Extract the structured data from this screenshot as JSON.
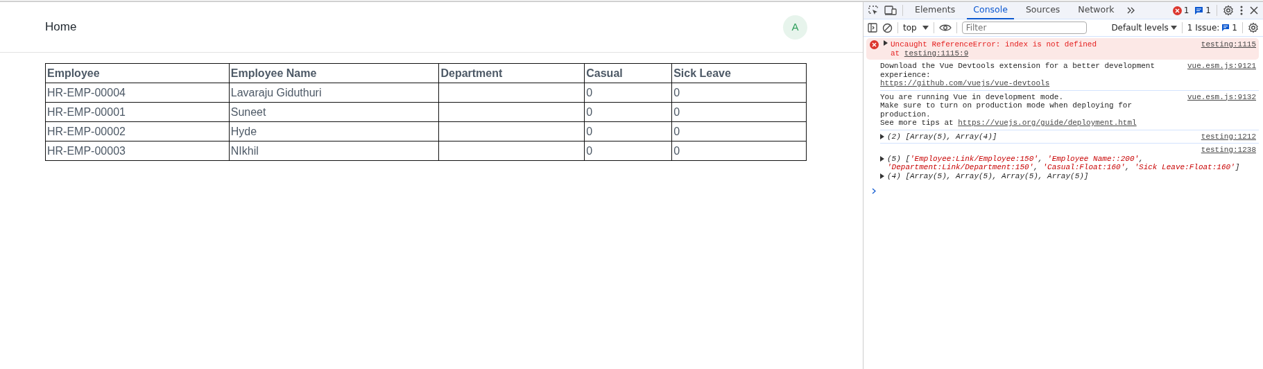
{
  "page": {
    "title": "Home",
    "avatar": "A",
    "table": {
      "columns": [
        "Employee",
        "Employee Name",
        "Department",
        "Casual",
        "Sick Leave"
      ],
      "rows": [
        [
          "HR-EMP-00004",
          "Lavaraju Giduthuri",
          "",
          "0",
          "0"
        ],
        [
          "HR-EMP-00001",
          "Suneet",
          "",
          "0",
          "0"
        ],
        [
          "HR-EMP-00002",
          "Hyde",
          "",
          "0",
          "0"
        ],
        [
          "HR-EMP-00003",
          "NIkhil",
          "",
          "0",
          "0"
        ]
      ]
    }
  },
  "devtools": {
    "tabs": [
      {
        "label": "Elements",
        "selected": false
      },
      {
        "label": "Console",
        "selected": true
      },
      {
        "label": "Sources",
        "selected": false
      },
      {
        "label": "Network",
        "selected": false
      }
    ],
    "error_count": "1",
    "message_count": "1",
    "context": "top",
    "filter": {
      "placeholder": "Filter"
    },
    "levels": "Default levels",
    "issues_label": "1 Issue:",
    "issues_count": "1",
    "messages": [
      {
        "kind": "error",
        "text": "Uncaught ReferenceError: index is not defined",
        "detail": "at ",
        "detail_link": "testing:1115:9",
        "source": "testing:1115"
      },
      {
        "kind": "info",
        "text": "Download the Vue Devtools extension for a better development experience:\n",
        "link": "https://github.com/vuejs/vue-devtools",
        "source": "vue.esm.js:9121"
      },
      {
        "kind": "info",
        "text": "You are running Vue in development mode.\nMake sure to turn on production mode when deploying for production.\nSee more tips at ",
        "link": "https://vuejs.org/guide/deployment.html",
        "source": "vue.esm.js:9132"
      },
      {
        "kind": "log",
        "source": "testing:1212",
        "entries": [
          [
            {
              "text": "(2) [Array(5), Array(4)]",
              "string": false
            }
          ]
        ]
      },
      {
        "kind": "log",
        "source": "testing:1238",
        "entries": [
          [
            {
              "text": "(5) [",
              "string": false
            },
            {
              "text": "'Employee:Link/Employee:150'",
              "string": true
            },
            {
              "text": ", ",
              "string": false
            },
            {
              "text": "'Employee Name::200'",
              "string": true
            },
            {
              "text": ", ",
              "string": false
            },
            {
              "text": "'Department:Link/Department:150'",
              "string": true
            },
            {
              "text": ", ",
              "string": false
            },
            {
              "text": "'Casual:Float:160'",
              "string": true
            },
            {
              "text": ", ",
              "string": false
            },
            {
              "text": "'Sick Leave:Float:160'",
              "string": true
            },
            {
              "text": "]",
              "string": false
            }
          ],
          [
            {
              "text": "(4) [Array(5), Array(5), Array(5), Array(5)]",
              "string": false
            }
          ]
        ]
      }
    ]
  }
}
